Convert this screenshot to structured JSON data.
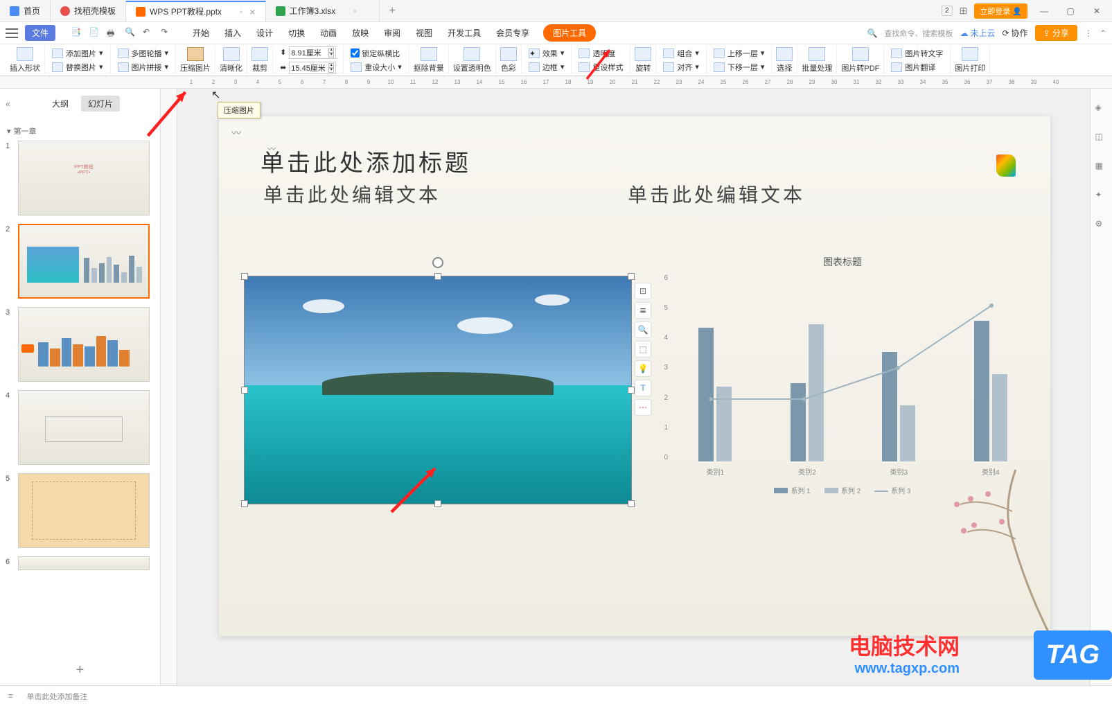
{
  "titlebar": {
    "tabs": [
      {
        "label": "首页",
        "icon_color": "#4b8bf4"
      },
      {
        "label": "找稻壳模板",
        "icon_color": "#e94f4f"
      },
      {
        "label": "WPS PPT教程.pptx",
        "icon_color": "#ff6a00",
        "active": true
      },
      {
        "label": "工作簿3.xlsx",
        "icon_color": "#2ea44f"
      }
    ],
    "badge_number": "2",
    "login": "立即登录"
  },
  "menubar": {
    "file": "文件",
    "tabs": [
      "开始",
      "插入",
      "设计",
      "切换",
      "动画",
      "放映",
      "审阅",
      "视图",
      "开发工具",
      "会员专享",
      "图片工具"
    ],
    "active_tool": "图片工具",
    "search_placeholder": "查找命令、搜索模板",
    "cloud": "未上云",
    "collab": "协作",
    "share": "分享"
  },
  "ribbon": {
    "insert_shape": "插入形状",
    "add_image": "添加图片",
    "multi_outline": "多图轮播",
    "replace_image": "替换图片",
    "image_tile": "图片拼接",
    "compress_image": "压缩图片",
    "sharpen": "清晰化",
    "crop": "裁剪",
    "width_value": "8.91厘米",
    "height_value": "15.45厘米",
    "lock_ratio": "锁定纵横比",
    "reset_size": "重设大小",
    "remove_bg": "抠除背景",
    "set_transparent": "设置透明色",
    "color": "色彩",
    "effect": "效果",
    "transparency": "透明度",
    "border": "边框",
    "reset_style": "重设样式",
    "rotate": "旋转",
    "group": "组合",
    "align": "对齐",
    "move_up": "上移一层",
    "move_down": "下移一层",
    "select": "选择",
    "batch": "批量处理",
    "to_pdf": "图片转PDF",
    "to_text": "图片转文字",
    "translate": "图片翻译",
    "print": "图片打印"
  },
  "tooltip": {
    "compress": "压缩图片"
  },
  "sidebar": {
    "outline": "大纲",
    "slides": "幻灯片",
    "section": "第一章",
    "slide_numbers": [
      "1",
      "2",
      "3",
      "4",
      "5",
      "6"
    ]
  },
  "slide": {
    "title_placeholder": "单击此处添加标题",
    "text_placeholder_l": "单击此处编辑文本",
    "text_placeholder_r": "单击此处编辑文本"
  },
  "chart_data": {
    "type": "bar",
    "title": "图表标题",
    "categories": [
      "类别1",
      "类别2",
      "类别3",
      "类别4"
    ],
    "series": [
      {
        "name": "系列 1",
        "values": [
          4.3,
          2.5,
          3.5,
          4.5
        ]
      },
      {
        "name": "系列 2",
        "values": [
          2.4,
          4.4,
          1.8,
          2.8
        ]
      },
      {
        "name": "系列 3",
        "values": [
          2.0,
          2.0,
          3.0,
          5.0
        ]
      }
    ],
    "ylim": [
      0,
      6
    ],
    "y_ticks": [
      0,
      1,
      2,
      3,
      4,
      5,
      6
    ],
    "legend": [
      "系列 1",
      "系列 2",
      "系列 3"
    ]
  },
  "statusbar": {
    "notes_placeholder": "单击此处添加备注"
  },
  "watermark": {
    "text1": "电脑技术网",
    "text2": "www.tagxp.com",
    "tag": "TAG"
  }
}
